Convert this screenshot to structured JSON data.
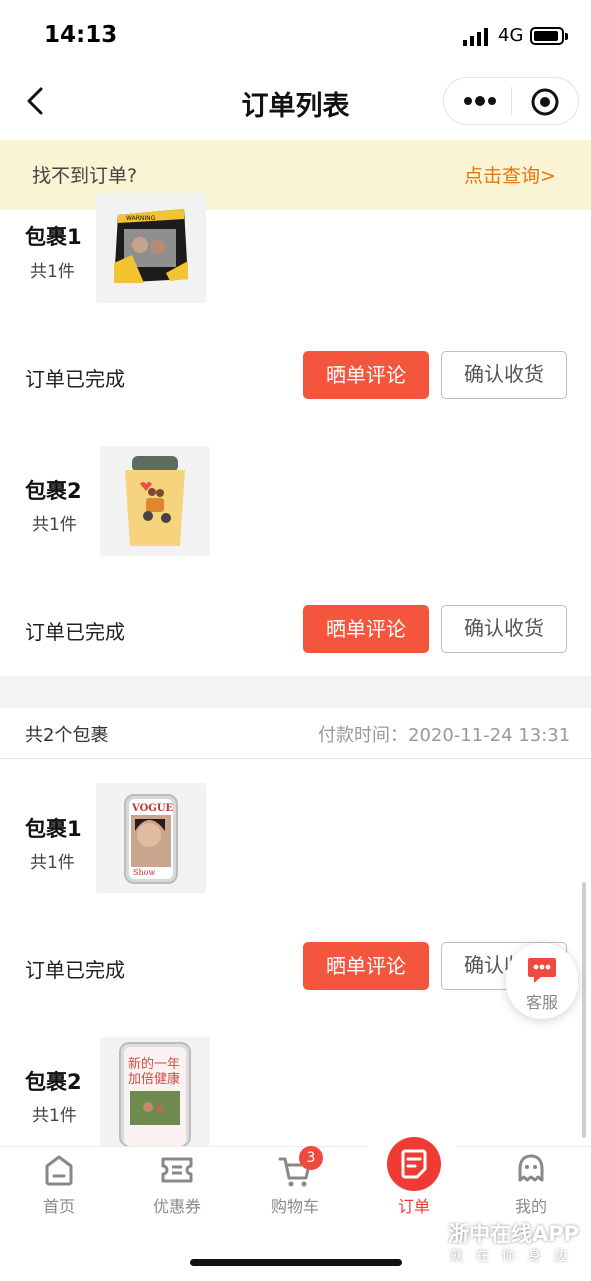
{
  "status_bar": {
    "time": "14:13",
    "network": "4G"
  },
  "nav": {
    "title": "订单列表"
  },
  "notice": {
    "text": "找不到订单?",
    "link": "点击查询>"
  },
  "orders": [
    {
      "packages": [
        {
          "name": "包裹1",
          "count": "共1件",
          "status": "订单已完成",
          "review_btn": "晒单评论",
          "confirm_btn": "确认收货",
          "thumb_text": "WARNING"
        },
        {
          "name": "包裹2",
          "count": "共1件",
          "status": "订单已完成",
          "review_btn": "晒单评论",
          "confirm_btn": "确认收货"
        }
      ]
    },
    {
      "header_left": "共2个包裹",
      "header_right": "付款时间：2020-11-24 13:31",
      "packages": [
        {
          "name": "包裹1",
          "count": "共1件",
          "status": "订单已完成",
          "review_btn": "晒单评论",
          "confirm_btn": "确认收货",
          "thumb_text_top": "VOGUE",
          "thumb_text_bottom": "Show"
        },
        {
          "name": "包裹2",
          "count": "共1件",
          "thumb_text_line1": "新的一年",
          "thumb_text_line2": "加倍健康"
        }
      ]
    }
  ],
  "service": {
    "label": "客服"
  },
  "tabbar": {
    "items": [
      {
        "label": "首页",
        "icon": "home-icon"
      },
      {
        "label": "优惠券",
        "icon": "coupon-icon"
      },
      {
        "label": "购物车",
        "icon": "cart-icon",
        "badge": "3"
      },
      {
        "label": "订单",
        "icon": "order-icon",
        "active": true
      },
      {
        "label": "我的",
        "icon": "profile-icon"
      }
    ]
  },
  "watermark": {
    "main": "浙中在线APP",
    "sub": "就在你身边"
  },
  "colors": {
    "accent": "#f4563d",
    "notice_bg": "#fbf4d4",
    "link": "#e3760f",
    "tab_active": "#ef3b34"
  }
}
